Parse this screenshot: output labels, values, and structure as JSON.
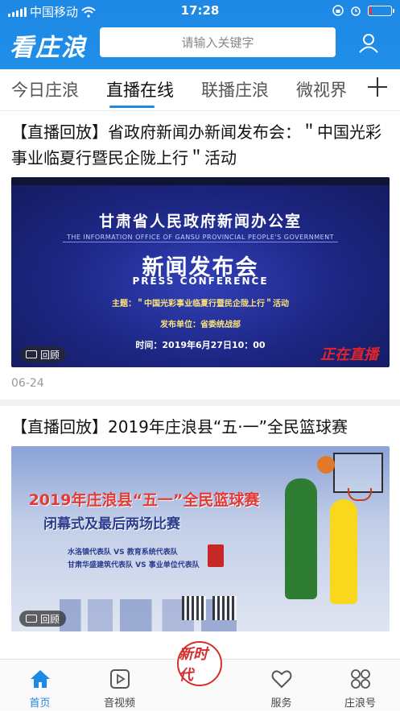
{
  "status_bar": {
    "carrier": "中国移动",
    "time": "17:28",
    "battery_level": 0.1,
    "battery_color": "#e53935"
  },
  "header": {
    "logo": "看庄浪",
    "search_placeholder": "请输入关键字",
    "accent": "#1e88e5"
  },
  "tabs": [
    {
      "label": "今日庄浪",
      "active": false
    },
    {
      "label": "直播在线",
      "active": true
    },
    {
      "label": "联播庄浪",
      "active": false
    },
    {
      "label": "微视界",
      "active": false
    }
  ],
  "feed": [
    {
      "title": "【直播回放】省政府新闻办新闻发布会：＂中国光彩事业临夏行暨民企陇上行＂活动",
      "badge": "回顾",
      "date": "06-24",
      "thumbnail": {
        "heading": "甘肃省人民政府新闻办公室",
        "heading_en": "THE INFORMATION OFFICE OF GANSU PROVINCIAL PEOPLE'S GOVERNMENT",
        "title": "新闻发布会",
        "title_en": "PRESS CONFERENCE",
        "theme": "主题：＂中国光彩事业临夏行暨民企陇上行＂活动",
        "unit": "发布单位：省委统战部",
        "time": "时间：2019年6月27日10：00",
        "stamp": "正在直播"
      }
    },
    {
      "title": "【直播回放】2019年庄浪县“五·一”全民篮球赛",
      "badge": "回顾",
      "thumbnail": {
        "heading": "2019年庄浪县“五一”全民篮球赛",
        "subheading": "闭幕式及最后两场比赛",
        "match1": "水洛镇代表队 VS 教育系统代表队",
        "match2": "甘肃华盛建筑代表队 VS 事业单位代表队"
      }
    }
  ],
  "bottom_nav": [
    {
      "label": "首页",
      "icon": "home-icon",
      "active": true
    },
    {
      "label": "音视频",
      "icon": "play-icon",
      "active": false
    },
    {
      "label": "新时代",
      "icon": "logo-icon",
      "active": false
    },
    {
      "label": "服务",
      "icon": "heart-icon",
      "active": false
    },
    {
      "label": "庄浪号",
      "icon": "grid-icon",
      "active": false
    }
  ]
}
